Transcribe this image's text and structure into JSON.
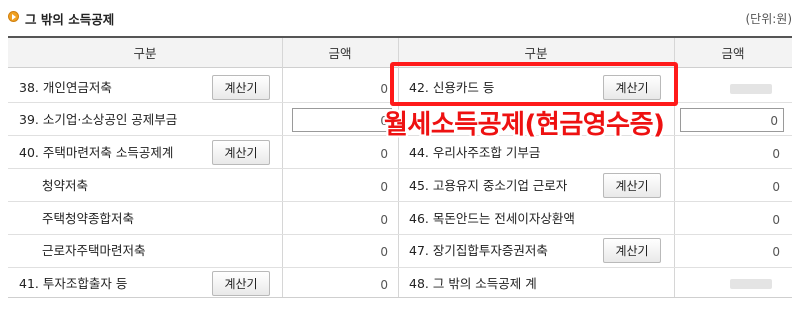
{
  "section": {
    "title": "그 밖의 소득공제",
    "unit": "(단위:원)"
  },
  "headers": {
    "left_category": "구분",
    "left_amount": "금액",
    "right_category": "구분",
    "right_amount": "금액"
  },
  "left_rows": [
    {
      "label": "38. 개인연금저축",
      "button": "계산기",
      "value": "0"
    },
    {
      "label": "39. 소기업·소상공인 공제부금",
      "button": "",
      "value": "0"
    },
    {
      "label": "40. 주택마련저축 소득공제계",
      "button": "계산기",
      "value": "0"
    },
    {
      "label": "청약저축",
      "button": "",
      "value": "0"
    },
    {
      "label": "주택청약종합저축",
      "button": "",
      "value": "0"
    },
    {
      "label": "근로자주택마련저축",
      "button": "",
      "value": "0"
    },
    {
      "label": "41. 투자조합출자 등",
      "button": "계산기",
      "value": "0"
    }
  ],
  "right_rows": [
    {
      "label": "42. 신용카드 등",
      "button": "계산기",
      "value": ""
    },
    {
      "label": "43. 월세소득공제",
      "button": "",
      "value": "0"
    },
    {
      "label": "44. 우리사주조합 기부금",
      "button": "",
      "value": "0"
    },
    {
      "label": "45. 고용유지 중소기업 근로자",
      "button": "계산기",
      "value": "0"
    },
    {
      "label": "46. 목돈안드는 전세이자상환액",
      "button": "",
      "value": "0"
    },
    {
      "label": "47. 장기집합투자증권저축",
      "button": "계산기",
      "value": "0"
    },
    {
      "label": "48. 그 밖의 소득공제 계",
      "button": "",
      "value": ""
    }
  ],
  "annotation": {
    "text": "월세소득공제(현금영수증)",
    "color": "#ee1111"
  },
  "colors": {
    "header_bg": "#f3f3f3",
    "highlight_border": "#ff1a1a"
  }
}
